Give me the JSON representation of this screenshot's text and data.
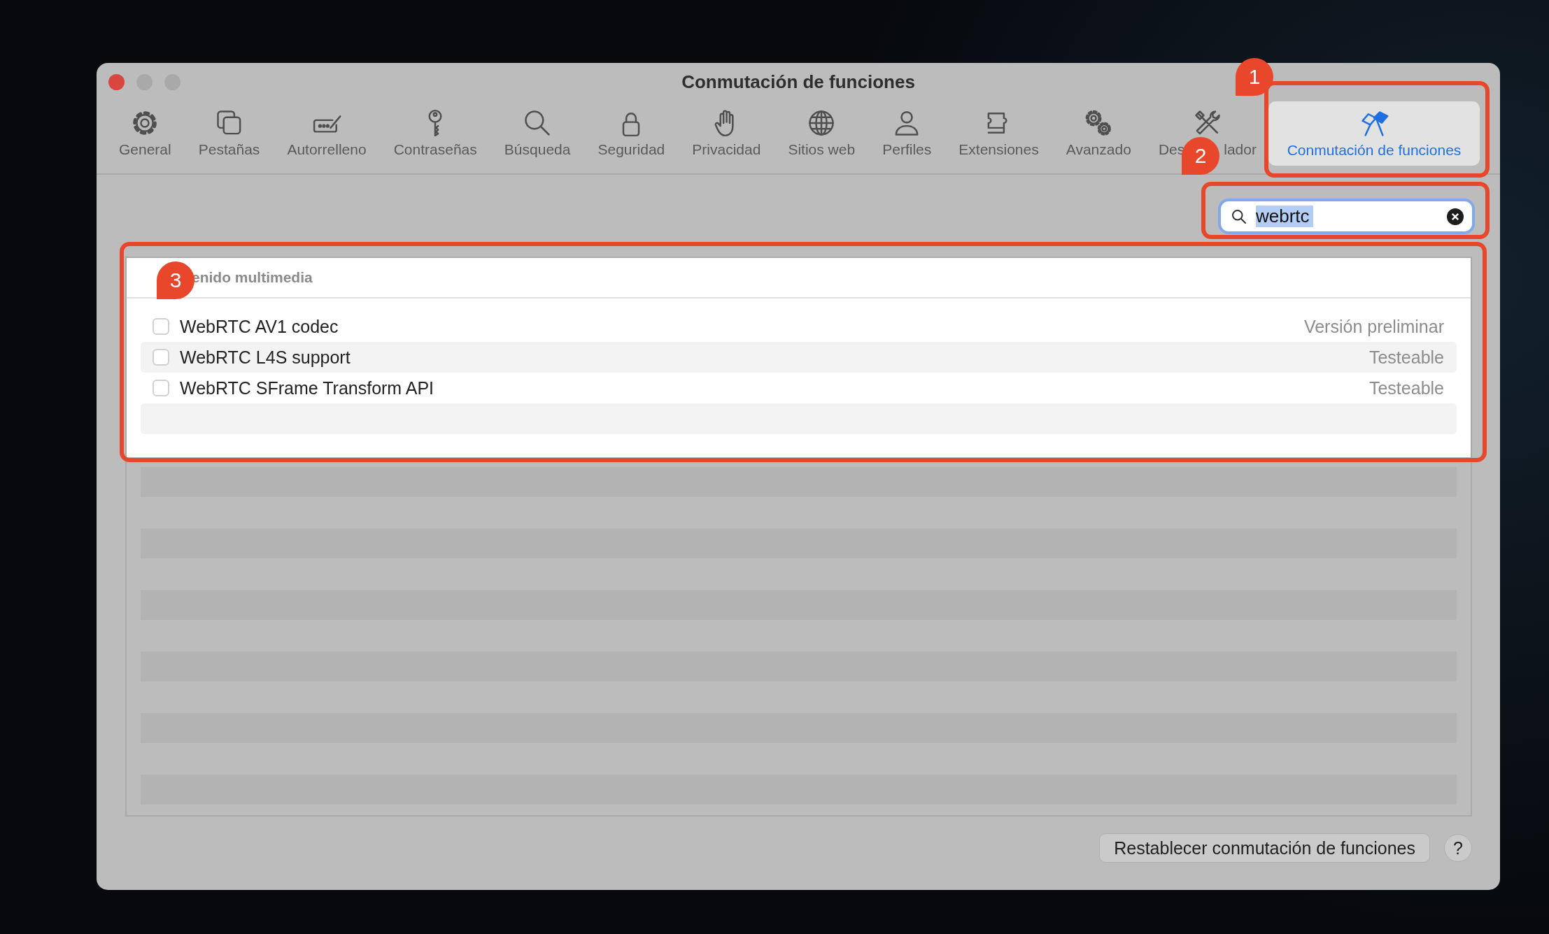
{
  "window": {
    "title": "Conmutación de funciones"
  },
  "toolbar": [
    {
      "label": "General",
      "selected": false
    },
    {
      "label": "Pestañas",
      "selected": false
    },
    {
      "label": "Autorrelleno",
      "selected": false
    },
    {
      "label": "Contraseñas",
      "selected": false
    },
    {
      "label": "Búsqueda",
      "selected": false
    },
    {
      "label": "Seguridad",
      "selected": false
    },
    {
      "label": "Privacidad",
      "selected": false
    },
    {
      "label": "Sitios web",
      "selected": false
    },
    {
      "label": "Perfiles",
      "selected": false
    },
    {
      "label": "Extensiones",
      "selected": false
    },
    {
      "label": "Avanzado",
      "selected": false
    },
    {
      "label_visible": [
        "Des",
        "lador"
      ],
      "selected": false
    },
    {
      "label": "Conmutación de funciones",
      "selected": true
    }
  ],
  "search": {
    "value": "webrtc",
    "value_selected": true
  },
  "list": {
    "section_header": "enido multimedia",
    "rows": [
      {
        "name": "WebRTC AV1 codec",
        "checked": false,
        "status": "Versión preliminar"
      },
      {
        "name": "WebRTC L4S support",
        "checked": false,
        "status": "Testeable"
      },
      {
        "name": "WebRTC SFrame Transform API",
        "checked": false,
        "status": "Testeable"
      }
    ]
  },
  "reset_button": "Restablecer conmutación de funciones",
  "help_button": "?",
  "annotations": [
    {
      "number": "1"
    },
    {
      "number": "2"
    },
    {
      "number": "3"
    }
  ]
}
